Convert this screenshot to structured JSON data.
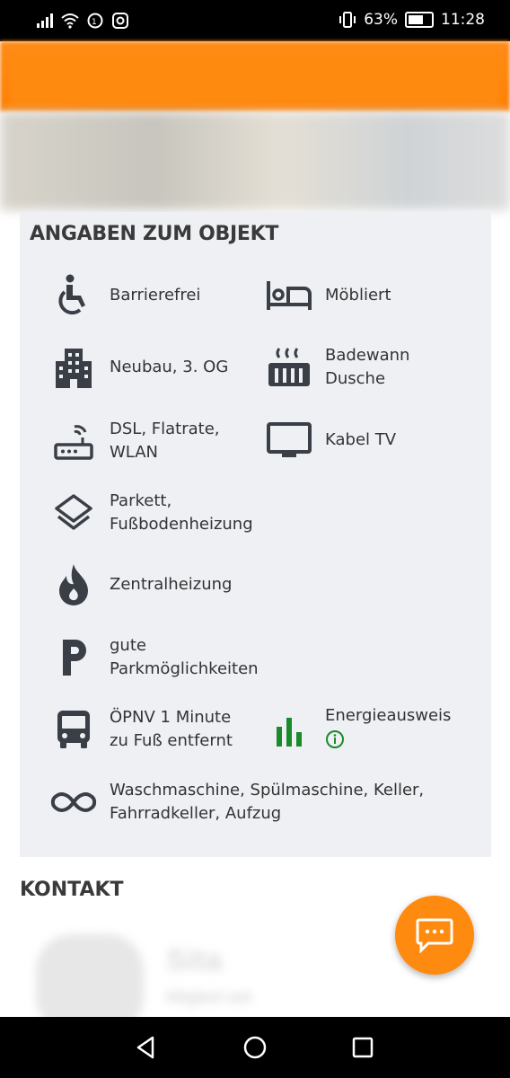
{
  "status_bar": {
    "battery": "63%",
    "time": "11:28"
  },
  "section_title": "ANGABEN ZUM OBJEKT",
  "features": {
    "barrierefrei": "Barrierefrei",
    "moebliert": "Möbliert",
    "neubau": "Neubau, 3. OG",
    "bad_line1": "Badewann",
    "bad_line2": "Dusche",
    "internet_line1": "DSL, Flatrate,",
    "internet_line2": "WLAN",
    "tv": "Kabel TV",
    "boden_line1": "Parkett,",
    "boden_line2": "Fußbodenheizung",
    "heizung": "Zentralheizung",
    "parken_line1": "gute",
    "parken_line2": "Parkmöglichkeiten",
    "oepnv_line1": "ÖPNV 1 Minute",
    "oepnv_line2": "zu Fuß entfernt",
    "energie": "Energieausweis",
    "extras_line1": "Waschmaschine, Spülmaschine, Keller,",
    "extras_line2": "Fahrradkeller, Aufzug"
  },
  "contact": {
    "title": "KONTAKT",
    "name_blurred": "Sita",
    "sub_blurred": "Mitglied seit"
  },
  "colors": {
    "accent": "#ff8a10",
    "panel": "#eef0f4",
    "energy_green": "#1a8a2a",
    "icon": "#3a3f47"
  }
}
